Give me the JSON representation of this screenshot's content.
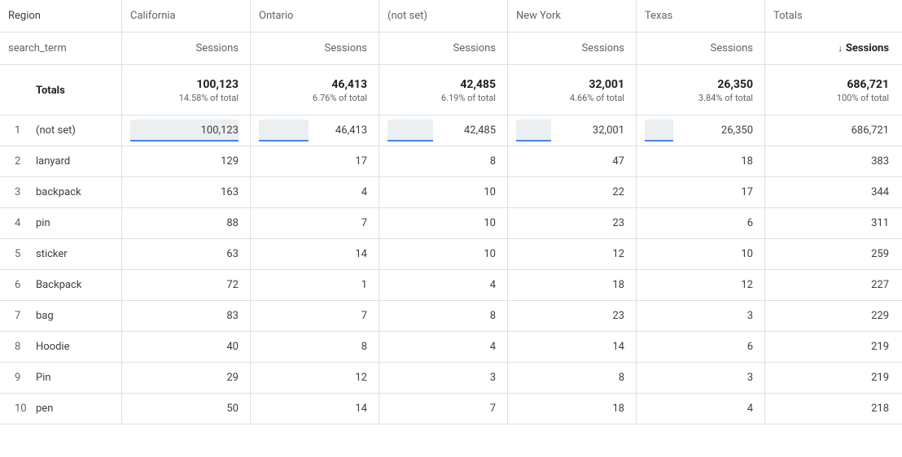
{
  "header": {
    "dimension_label": "Region",
    "row_dimension_label": "search_term",
    "metric_label": "Sessions",
    "totals_column_label": "Totals",
    "sorted_metric_label": "Sessions",
    "regions": [
      "California",
      "Ontario",
      "(not set)",
      "New York",
      "Texas"
    ]
  },
  "totals": {
    "label": "Totals",
    "columns": [
      {
        "value": "100,123",
        "pct": "14.58% of total"
      },
      {
        "value": "46,413",
        "pct": "6.76% of total"
      },
      {
        "value": "42,485",
        "pct": "6.19% of total"
      },
      {
        "value": "32,001",
        "pct": "4.66% of total"
      },
      {
        "value": "26,350",
        "pct": "3.84% of total"
      }
    ],
    "grand": {
      "value": "686,721",
      "pct": "100% of total"
    }
  },
  "rows": [
    {
      "n": "1",
      "term": "(not set)",
      "v": [
        "100,123",
        "46,413",
        "42,485",
        "32,001",
        "26,350"
      ],
      "tot": "686,721",
      "bars": [
        1.0,
        0.46,
        0.42,
        0.32,
        0.26
      ]
    },
    {
      "n": "2",
      "term": "lanyard",
      "v": [
        "129",
        "17",
        "8",
        "47",
        "18"
      ],
      "tot": "383"
    },
    {
      "n": "3",
      "term": "backpack",
      "v": [
        "163",
        "4",
        "10",
        "22",
        "17"
      ],
      "tot": "344"
    },
    {
      "n": "4",
      "term": "pin",
      "v": [
        "88",
        "7",
        "10",
        "23",
        "6"
      ],
      "tot": "311"
    },
    {
      "n": "5",
      "term": "sticker",
      "v": [
        "63",
        "14",
        "10",
        "12",
        "10"
      ],
      "tot": "259"
    },
    {
      "n": "6",
      "term": "Backpack",
      "v": [
        "72",
        "1",
        "4",
        "18",
        "12"
      ],
      "tot": "227"
    },
    {
      "n": "7",
      "term": "bag",
      "v": [
        "83",
        "7",
        "8",
        "23",
        "3"
      ],
      "tot": "229"
    },
    {
      "n": "8",
      "term": "Hoodie",
      "v": [
        "40",
        "8",
        "4",
        "14",
        "6"
      ],
      "tot": "219"
    },
    {
      "n": "9",
      "term": "Pin",
      "v": [
        "29",
        "12",
        "3",
        "8",
        "3"
      ],
      "tot": "219"
    },
    {
      "n": "10",
      "term": "pen",
      "v": [
        "50",
        "14",
        "7",
        "18",
        "4"
      ],
      "tot": "218"
    }
  ]
}
